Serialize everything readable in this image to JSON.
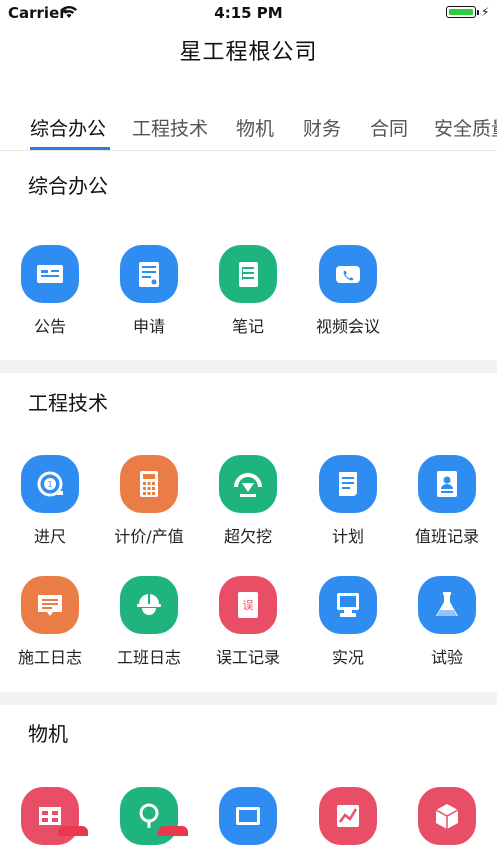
{
  "status": {
    "carrier": "Carrier",
    "time": "4:15 PM"
  },
  "nav": {
    "title": "星工程根公司"
  },
  "tabs": [
    "综合办公",
    "工程技术",
    "物机",
    "财务",
    "合同",
    "安全质量"
  ],
  "sections": {
    "office": {
      "title": "综合办公",
      "items": [
        {
          "label": "公告",
          "icon": "announcement-icon",
          "color": "#2f8cf0"
        },
        {
          "label": "申请",
          "icon": "application-form-icon",
          "color": "#2f8cf0"
        },
        {
          "label": "笔记",
          "icon": "notes-icon",
          "color": "#1fb47d"
        },
        {
          "label": "视频会议",
          "icon": "video-call-icon",
          "color": "#2f8cf0"
        }
      ]
    },
    "engineering": {
      "title": "工程技术",
      "items": [
        {
          "label": "进尺",
          "icon": "tape-measure-icon",
          "color": "#2f8cf0"
        },
        {
          "label": "计价/产值",
          "icon": "calculator-icon",
          "color": "#ea7d45"
        },
        {
          "label": "超欠挖",
          "icon": "excavation-gauge-icon",
          "color": "#1fb47d"
        },
        {
          "label": "计划",
          "icon": "plan-scroll-icon",
          "color": "#2f8cf0"
        },
        {
          "label": "值班记录",
          "icon": "duty-record-icon",
          "color": "#2f8cf0"
        },
        {
          "label": "施工日志",
          "icon": "construction-log-icon",
          "color": "#ea7d45"
        },
        {
          "label": "工班日志",
          "icon": "worker-helmet-icon",
          "color": "#1fb47d"
        },
        {
          "label": "误工记录",
          "icon": "error-record-book-icon",
          "color": "#e84e66"
        },
        {
          "label": "实况",
          "icon": "live-monitor-icon",
          "color": "#2f8cf0"
        },
        {
          "label": "试验",
          "icon": "lab-flask-icon",
          "color": "#2f8cf0"
        }
      ]
    },
    "materials": {
      "title": "物机",
      "items": [
        {
          "icon": "warehouse-icon",
          "color": "#e84e66"
        },
        {
          "icon": "search-location-icon",
          "color": "#1fb47d"
        },
        {
          "icon": "equipment-icon",
          "color": "#2f8cf0"
        },
        {
          "icon": "trend-chart-icon",
          "color": "#e84e66"
        },
        {
          "icon": "package-icon",
          "color": "#e84e66"
        }
      ]
    }
  }
}
